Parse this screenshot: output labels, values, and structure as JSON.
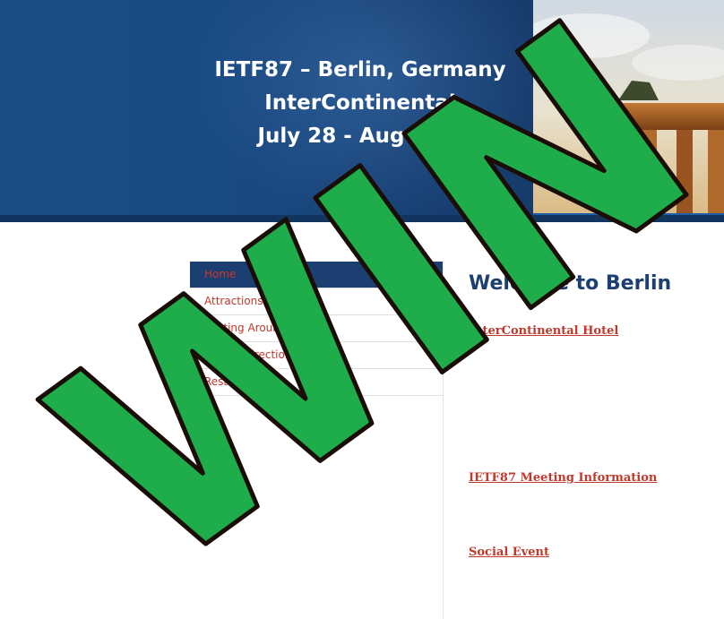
{
  "header": {
    "title_line1": "IETF87 – Berlin, Germany",
    "title_line2": "InterContinental",
    "title_line3": "July 28 - August 2"
  },
  "nav": {
    "items": [
      {
        "label": "Home",
        "active": true
      },
      {
        "label": "Attractions"
      },
      {
        "label": "Getting Around"
      },
      {
        "label": "Maps / Directions"
      },
      {
        "label": "Restaurants"
      }
    ]
  },
  "main": {
    "welcome_heading": "Welcome to Berlin",
    "intercontinental_link": "InterContinental Hotel",
    "meeting_info_link": "IETF87 Meeting Information",
    "social_event_link": "Social Event"
  },
  "overlay": {
    "text": "WIN",
    "fill_color": "#1fad4b",
    "stroke_color": "#1a0d05"
  },
  "colors": {
    "banner_blue": "#1d4d86",
    "nav_active": "#1b3f70",
    "link_red": "#c0392b",
    "heading_blue": "#1b3f70"
  }
}
